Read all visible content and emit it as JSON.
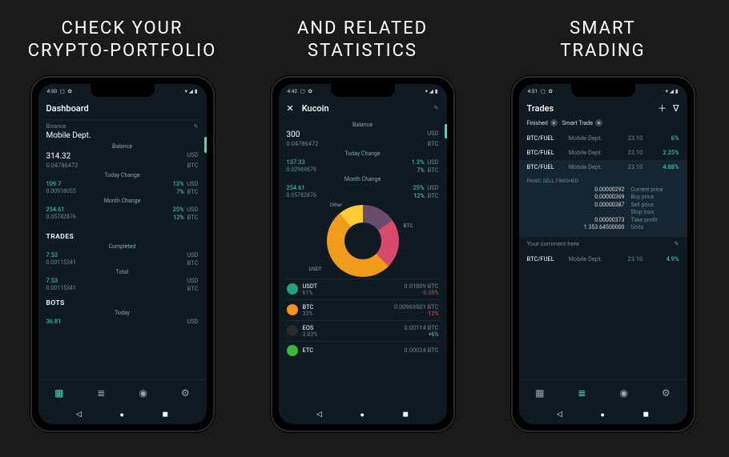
{
  "captions": {
    "c1a": "CHECK YOUR",
    "c1b": "CRYPTO-PORTFOLIO",
    "c2a": "AND RELATED",
    "c2b": "STATISTICS",
    "c3a": "SMART",
    "c3b": "TRADING"
  },
  "p1": {
    "time": "4:50",
    "title": "Dashboard",
    "exchange": "Binance",
    "account": "Mobile Dept.",
    "balance_label": "Balance",
    "balance_usd": "314.32",
    "usd": "USD",
    "balance_btc": "0.04786472",
    "btc": "BTC",
    "today_label": "Today Change",
    "today_usd": "109.7",
    "today_usd_pct": "13%",
    "today_btc": "0.00918055",
    "today_btc_pct": "7%",
    "month_label": "Month Change",
    "month_usd": "254.61",
    "month_usd_pct": "25%",
    "month_btc": "0.05782876",
    "month_btc_pct": "12%",
    "trades_title": "TRADES",
    "completed_label": "Completed",
    "comp_usd": "7.53",
    "comp_usd2": "USD",
    "comp_btc": "0.00115341",
    "comp_btc2": "BTC",
    "total_label": "Total",
    "tot_usd": "7.53",
    "tot_btc": "0.00115341",
    "bots_title": "BOTS",
    "bots_today_label": "Today",
    "bots_usd": "36.81"
  },
  "p2": {
    "time": "4:42",
    "title": "Kucoin",
    "balance_label": "Balance",
    "bal_usd": "300",
    "usd": "USD",
    "bal_btc": "0.04786472",
    "btc": "BTC",
    "today_label": "Today Change",
    "today_usd": "137.33",
    "today_usd_pct": "1.3%",
    "today_btc": "0.02969679",
    "today_btc_pct": "7%",
    "month_label": "Month Change",
    "month_usd": "254.61",
    "month_usd_pct": "25%",
    "month_btc": "0.05782876",
    "month_btc_pct": "12%",
    "donut_labels": {
      "other": "Other",
      "btc": "BTC",
      "usdt": "USDT"
    },
    "coins": [
      {
        "sym": "USDT",
        "share": "61%",
        "val": "0.01809 BTC",
        "chg": "-0.09%",
        "neg": true,
        "color": "#26a17b"
      },
      {
        "sym": "BTC",
        "share": "33%",
        "val": "0.00969501 BTC",
        "chg": "-12%",
        "neg": true,
        "color": "#f7931a"
      },
      {
        "sym": "EOS",
        "share": "3.83%",
        "val": "0.00114 BTC",
        "chg": "+6%",
        "neg": false,
        "color": "#2a2a2a"
      },
      {
        "sym": "ETC",
        "share": "",
        "val": "0.00024 BTC",
        "chg": "",
        "neg": false,
        "color": "#3ab83a"
      }
    ]
  },
  "p3": {
    "time": "4:51",
    "title": "Trades",
    "chip_finished": "Finished",
    "chip_smart": "Smart Trade",
    "rows": [
      {
        "pair": "BTC/FUEL",
        "acct": "Mobile Dept.",
        "date": "23.10",
        "pct": "6%"
      },
      {
        "pair": "BTC/FUEL",
        "acct": "Mobile Dept.",
        "date": "23.10",
        "pct": "2.25%"
      },
      {
        "pair": "BTC/FUEL",
        "acct": "Mobile Dept.",
        "date": "23.10",
        "pct": "4.88%"
      }
    ],
    "panic": "PANIC SELL FINISHED",
    "details": [
      {
        "v": "0.00000292",
        "l": "Current price"
      },
      {
        "v": "0.00000369",
        "l": "Buy price"
      },
      {
        "v": "0.00000387",
        "l": "Sell price"
      },
      {
        "v": "",
        "l": "Stop loss"
      },
      {
        "v": "0.00000373",
        "l": "Take profit"
      },
      {
        "v": "1 353.64500000",
        "l": "Units"
      }
    ],
    "comment_placeholder": "Your comment here",
    "row4": {
      "pair": "BTC/FUEL",
      "acct": "Mobile Dept.",
      "date": "23.10",
      "pct": "4.9%"
    }
  }
}
